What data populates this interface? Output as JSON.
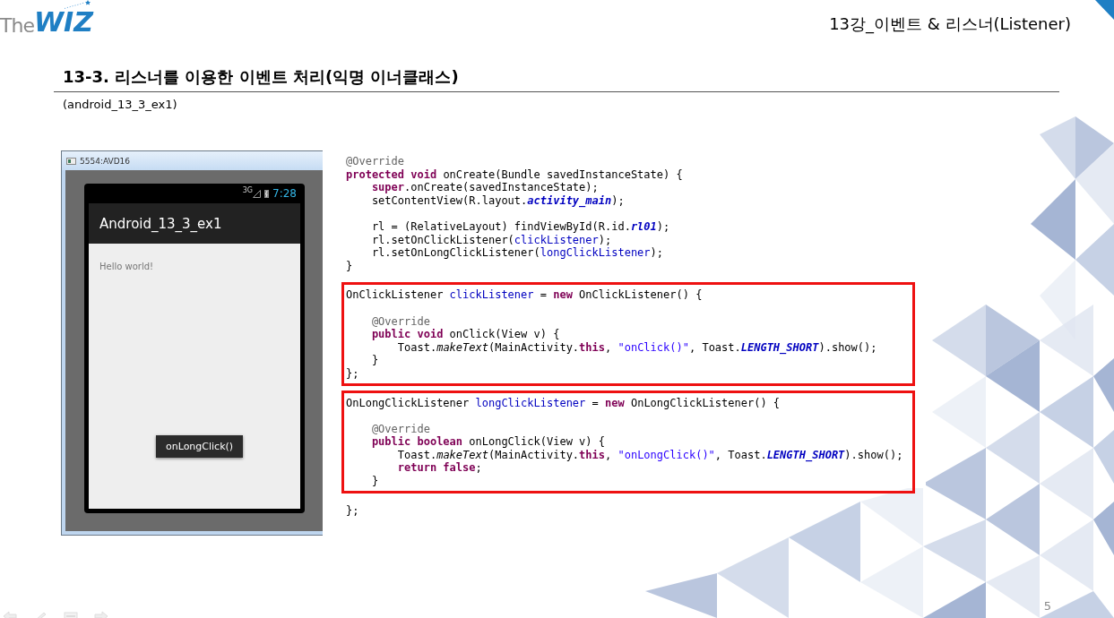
{
  "header": {
    "logo": {
      "prefix": "The",
      "name": "WIZ"
    },
    "chapter": "13강_이벤트 & 리스너(Listener)"
  },
  "slide": {
    "title": "13-3. 리스너를 이용한 이벤트 처리(익명 이너클래스)",
    "subtitle": "(android_13_3_ex1)",
    "page_number": "5"
  },
  "emulator": {
    "window_title": "5554:AVD16",
    "network": "3G",
    "clock": "7:28",
    "app_title": "Android_13_3_ex1",
    "content_text": "Hello world!",
    "toast": "onLongClick()"
  },
  "code_blocks": [
    {
      "highlighted": false,
      "lines": [
        {
          "gap_before": false,
          "tokens": [
            {
              "text": "@Override",
              "kind": "annotation"
            }
          ]
        },
        {
          "gap_before": false,
          "tokens": [
            {
              "text": "protected void",
              "kind": "keyword"
            },
            {
              "text": " onCreate(Bundle savedInstanceState) {",
              "kind": "plain"
            }
          ]
        },
        {
          "gap_before": false,
          "tokens": [
            {
              "text": "    super",
              "kind": "keyword"
            },
            {
              "text": ".onCreate(savedInstanceState);",
              "kind": "plain"
            }
          ]
        },
        {
          "gap_before": false,
          "tokens": [
            {
              "text": "    setContentView(R.layout.",
              "kind": "plain"
            },
            {
              "text": "activity_main",
              "kind": "constant"
            },
            {
              "text": ");",
              "kind": "plain"
            }
          ]
        },
        {
          "gap_before": true,
          "tokens": [
            {
              "text": "    rl = (RelativeLayout) findViewById(R.id.",
              "kind": "plain"
            },
            {
              "text": "rl01",
              "kind": "constant"
            },
            {
              "text": ");",
              "kind": "plain"
            }
          ]
        },
        {
          "gap_before": false,
          "tokens": [
            {
              "text": "    rl.setOnClickListener(",
              "kind": "plain"
            },
            {
              "text": "clickListener",
              "kind": "field"
            },
            {
              "text": ");",
              "kind": "plain"
            }
          ]
        },
        {
          "gap_before": false,
          "tokens": [
            {
              "text": "    rl.setOnLongClickListener(",
              "kind": "plain"
            },
            {
              "text": "longClickListener",
              "kind": "field"
            },
            {
              "text": ");",
              "kind": "plain"
            }
          ]
        },
        {
          "gap_before": false,
          "tokens": [
            {
              "text": "}",
              "kind": "plain"
            }
          ]
        }
      ]
    },
    {
      "highlighted": true,
      "lines": [
        {
          "gap_before": false,
          "tokens": [
            {
              "text": "OnClickListener ",
              "kind": "plain"
            },
            {
              "text": "clickListener",
              "kind": "field"
            },
            {
              "text": " = ",
              "kind": "plain"
            },
            {
              "text": "new",
              "kind": "keyword"
            },
            {
              "text": " OnClickListener() {",
              "kind": "plain"
            }
          ]
        },
        {
          "gap_before": true,
          "tokens": [
            {
              "text": "    @Override",
              "kind": "annotation"
            }
          ]
        },
        {
          "gap_before": false,
          "tokens": [
            {
              "text": "    public void",
              "kind": "keyword"
            },
            {
              "text": " onClick(View v) {",
              "kind": "plain"
            }
          ]
        },
        {
          "gap_before": false,
          "tokens": [
            {
              "text": "        Toast.",
              "kind": "plain"
            },
            {
              "text": "makeText",
              "kind": "method"
            },
            {
              "text": "(MainActivity.",
              "kind": "plain"
            },
            {
              "text": "this",
              "kind": "keyword"
            },
            {
              "text": ", ",
              "kind": "plain"
            },
            {
              "text": "\"onClick()\"",
              "kind": "string"
            },
            {
              "text": ", Toast.",
              "kind": "plain"
            },
            {
              "text": "LENGTH_SHORT",
              "kind": "constant"
            },
            {
              "text": ").show();",
              "kind": "plain"
            }
          ]
        },
        {
          "gap_before": false,
          "tokens": [
            {
              "text": "    }",
              "kind": "plain"
            }
          ]
        },
        {
          "gap_before": false,
          "tokens": [
            {
              "text": "};",
              "kind": "plain"
            }
          ]
        }
      ]
    },
    {
      "highlighted": true,
      "lines": [
        {
          "gap_before": false,
          "tokens": [
            {
              "text": "OnLongClickListener ",
              "kind": "plain"
            },
            {
              "text": "longClickListener",
              "kind": "field"
            },
            {
              "text": " = ",
              "kind": "plain"
            },
            {
              "text": "new",
              "kind": "keyword"
            },
            {
              "text": " OnLongClickListener() {",
              "kind": "plain"
            }
          ]
        },
        {
          "gap_before": true,
          "tokens": [
            {
              "text": "    @Override",
              "kind": "annotation"
            }
          ]
        },
        {
          "gap_before": false,
          "tokens": [
            {
              "text": "    public boolean",
              "kind": "keyword"
            },
            {
              "text": " onLongClick(View v) {",
              "kind": "plain"
            }
          ]
        },
        {
          "gap_before": false,
          "tokens": [
            {
              "text": "        Toast.",
              "kind": "plain"
            },
            {
              "text": "makeText",
              "kind": "method"
            },
            {
              "text": "(MainActivity.",
              "kind": "plain"
            },
            {
              "text": "this",
              "kind": "keyword"
            },
            {
              "text": ", ",
              "kind": "plain"
            },
            {
              "text": "\"onLongClick()\"",
              "kind": "string"
            },
            {
              "text": ", Toast.",
              "kind": "plain"
            },
            {
              "text": "LENGTH_SHORT",
              "kind": "constant"
            },
            {
              "text": ").show();",
              "kind": "plain"
            }
          ]
        },
        {
          "gap_before": false,
          "tokens": [
            {
              "text": "        return false",
              "kind": "keyword"
            },
            {
              "text": ";",
              "kind": "plain"
            }
          ]
        },
        {
          "gap_before": false,
          "tokens": [
            {
              "text": "    }",
              "kind": "plain"
            }
          ]
        }
      ]
    },
    {
      "highlighted": false,
      "lines": [
        {
          "gap_before": false,
          "tokens": [
            {
              "text": "};",
              "kind": "plain"
            }
          ]
        }
      ]
    }
  ]
}
